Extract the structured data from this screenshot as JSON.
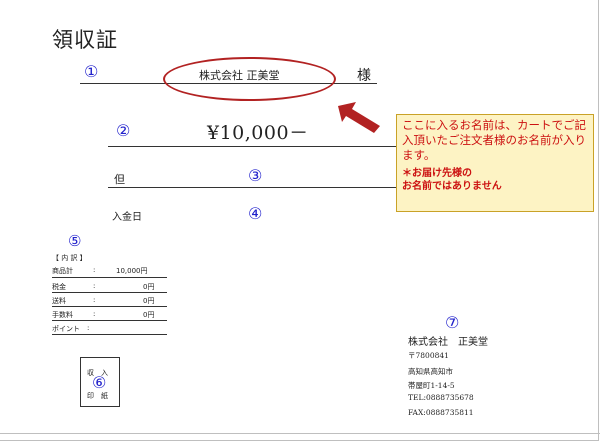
{
  "document": {
    "title": "領収証",
    "markers": [
      "①",
      "②",
      "③",
      "④",
      "⑤",
      "⑥",
      "⑦"
    ],
    "recipient_name": "株式会社 正美堂",
    "honorific": "様",
    "amount": "¥10,000－",
    "tadashi_label": "但",
    "payment_date_label": "入金日"
  },
  "callout": {
    "main_text": "ここに入るお名前は、カートでご記入頂いたご注文者様のお名前が入ります。",
    "note_prefix": "＊",
    "note_text": "お届け先様の\nお名前ではありません"
  },
  "breakdown": {
    "heading": "【 内 訳 】",
    "rows": [
      {
        "label": "商品計",
        "sep": ":",
        "value": "10,000円"
      },
      {
        "label": "税金",
        "sep": ":",
        "value": "0円"
      },
      {
        "label": "送料",
        "sep": ":",
        "value": "0円"
      },
      {
        "label": "手数料",
        "sep": ":",
        "value": "0円"
      },
      {
        "label": "ポイント",
        "sep": ":",
        "value": ""
      }
    ]
  },
  "stamp": {
    "top": "収　入",
    "bottom": "印　紙"
  },
  "issuer": {
    "company": "株式会社　正美堂",
    "postal": "〒7800841",
    "address1": "高知県高知市",
    "address2": "帯屋町1-14-5",
    "tel": "TEL:0888735678",
    "fax": "FAX:0888735811"
  },
  "colors": {
    "marker": "#2222cc",
    "oval": "#b22222",
    "arrow": "#b22222",
    "callout_bg": "#fdf3c4",
    "callout_text": "#cc1111"
  }
}
